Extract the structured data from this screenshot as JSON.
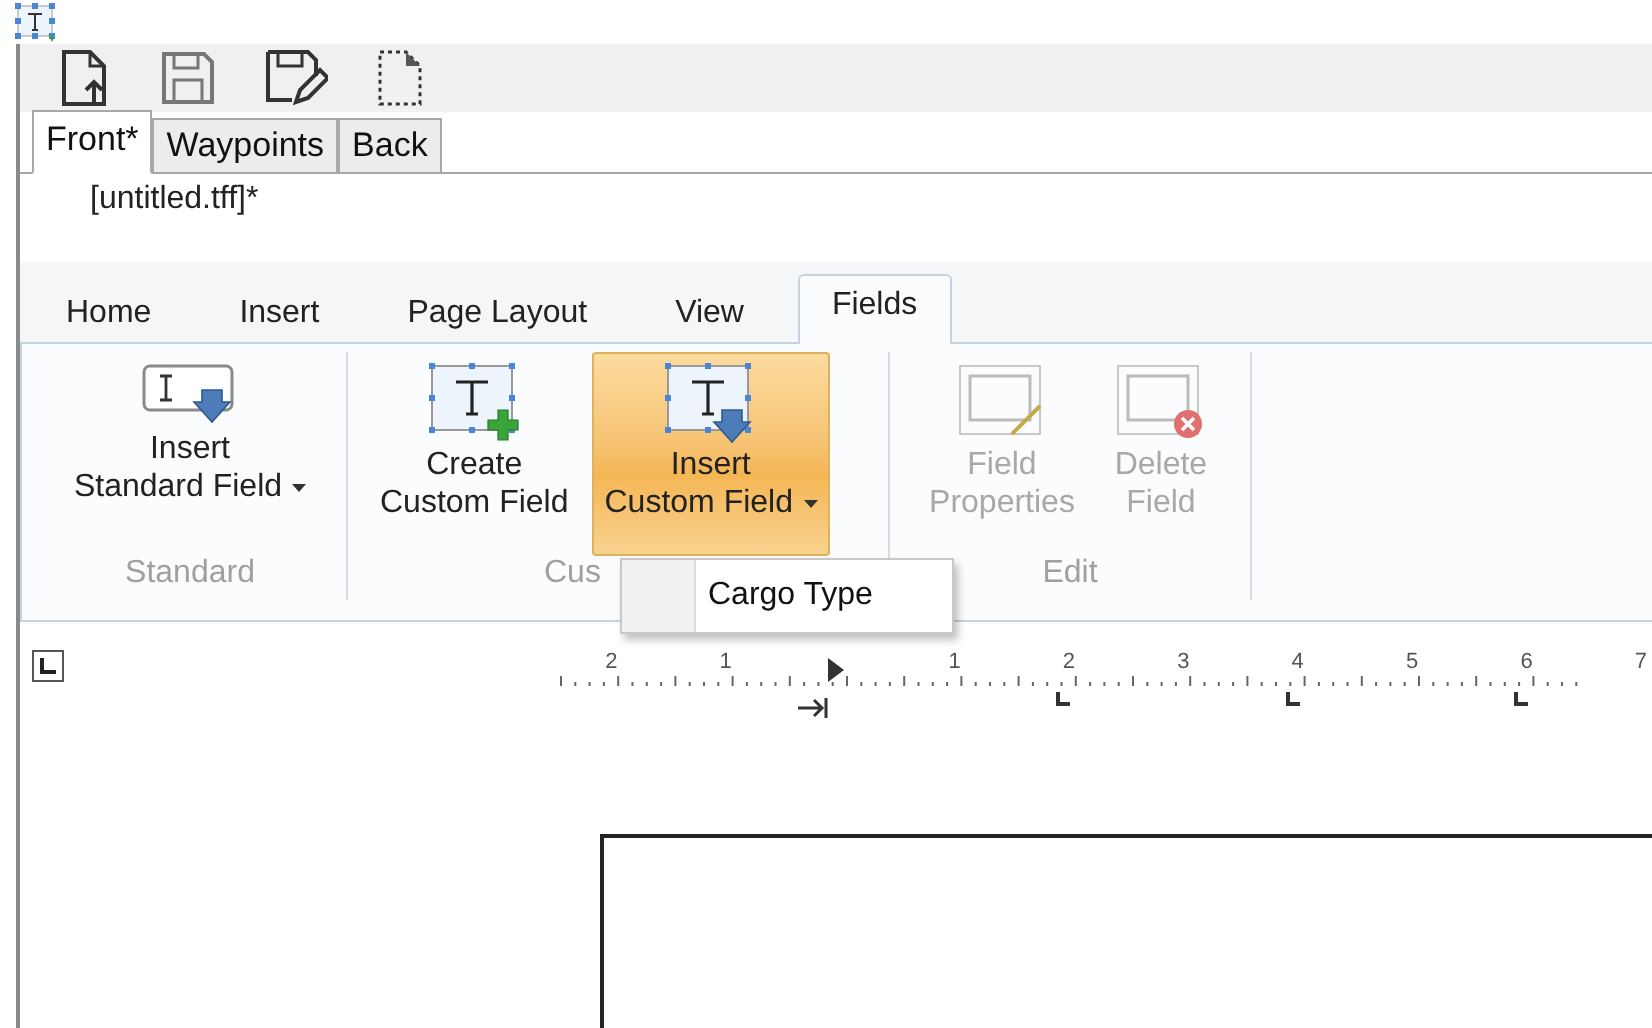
{
  "document_tabs": [
    {
      "label": "Front*",
      "selected": true
    },
    {
      "label": "Waypoints",
      "selected": false
    },
    {
      "label": "Back",
      "selected": false
    }
  ],
  "document_title": "[untitled.tff]*",
  "ribbon_tabs": [
    {
      "label": "Home",
      "selected": false
    },
    {
      "label": "Insert",
      "selected": false
    },
    {
      "label": "Page Layout",
      "selected": false
    },
    {
      "label": "View",
      "selected": false
    },
    {
      "label": "Fields",
      "selected": true
    }
  ],
  "ribbon_groups": [
    {
      "label": "Standard",
      "buttons": [
        {
          "kind": "insert-standard",
          "lines": [
            "Insert",
            "Standard Field"
          ],
          "dropdown": true,
          "highlighted": false,
          "disabled": false
        }
      ]
    },
    {
      "label": "Cus",
      "buttons": [
        {
          "kind": "create-custom",
          "lines": [
            "Create",
            "Custom Field"
          ],
          "dropdown": false,
          "highlighted": false,
          "disabled": false
        },
        {
          "kind": "insert-custom",
          "lines": [
            "Insert",
            "Custom Field"
          ],
          "dropdown": true,
          "highlighted": true,
          "disabled": false
        }
      ]
    },
    {
      "label": "Edit",
      "buttons": [
        {
          "kind": "field-properties",
          "lines": [
            "Field",
            "Properties"
          ],
          "dropdown": false,
          "highlighted": false,
          "disabled": true
        },
        {
          "kind": "delete-field",
          "lines": [
            "Delete",
            "Field"
          ],
          "dropdown": false,
          "highlighted": false,
          "disabled": true
        }
      ]
    }
  ],
  "dropdown_menu": {
    "items": [
      {
        "label": "Cargo Type"
      }
    ]
  },
  "ruler": {
    "labels": [
      "2",
      "1",
      "1",
      "2",
      "3",
      "4",
      "5",
      "6",
      "7"
    ]
  }
}
